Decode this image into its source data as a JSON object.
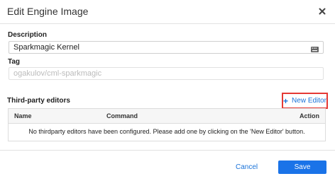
{
  "dialog": {
    "title": "Edit Engine Image",
    "close_icon": "close-icon"
  },
  "form": {
    "description": {
      "label": "Description",
      "value": "Sparkmagic Kernel",
      "icon": "keyboard-icon"
    },
    "tag": {
      "label": "Tag",
      "value": "ogakulov/cml-sparkmagic"
    }
  },
  "editors": {
    "section_label": "Third-party editors",
    "new_editor_label": "New Editor",
    "new_editor_icon": "plus-icon",
    "highlight_color": "#e53935",
    "columns": [
      "Name",
      "Command",
      "Action"
    ],
    "empty_message": "No thirdparty editors have been configured. Please add one by clicking on the 'New Editor' button."
  },
  "footer": {
    "cancel_label": "Cancel",
    "save_label": "Save",
    "accent": "#1a73e8"
  }
}
